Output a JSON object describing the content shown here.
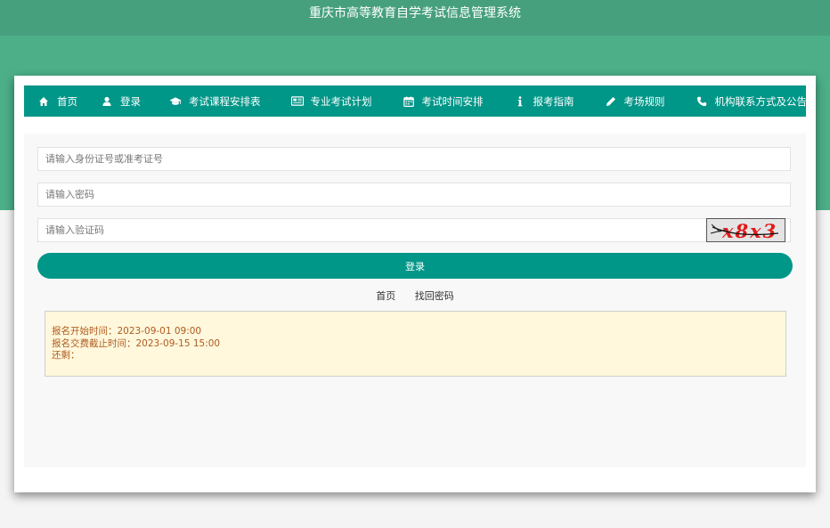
{
  "header": {
    "title": "重庆市高等教育自学考试信息管理系统"
  },
  "nav": {
    "items": [
      {
        "label": "首页",
        "icon": "home-icon"
      },
      {
        "label": "登录",
        "icon": "user-icon"
      },
      {
        "label": "考试课程安排表",
        "icon": "graduation-cap-icon"
      },
      {
        "label": "专业考试计划",
        "icon": "newspaper-icon"
      },
      {
        "label": "考试时间安排",
        "icon": "calendar-icon"
      },
      {
        "label": "报考指南",
        "icon": "info-icon"
      },
      {
        "label": "考场规则",
        "icon": "pencil-icon"
      },
      {
        "label": "机构联系方式及公告",
        "icon": "phone-icon"
      }
    ]
  },
  "form": {
    "id_placeholder": "请输入身份证号或准考证号",
    "password_placeholder": "请输入密码",
    "captcha_placeholder": "请输入验证码",
    "captcha_text": "x8x3",
    "login_label": "登录"
  },
  "links": {
    "home": "首页",
    "recover": "找回密码"
  },
  "notice": {
    "line1": "报名开始时间：2023-09-01 09:00",
    "line2": "报名交费截止时间：2023-09-15 15:00",
    "line3": "还剩："
  },
  "colors": {
    "header_band": "#46a07e",
    "green_band": "#4caf88",
    "nav_bg": "#009688",
    "button_bg": "#009688",
    "notice_bg": "#fff8dc",
    "notice_text": "#b05a1e",
    "captcha_text": "#e01a1a"
  }
}
